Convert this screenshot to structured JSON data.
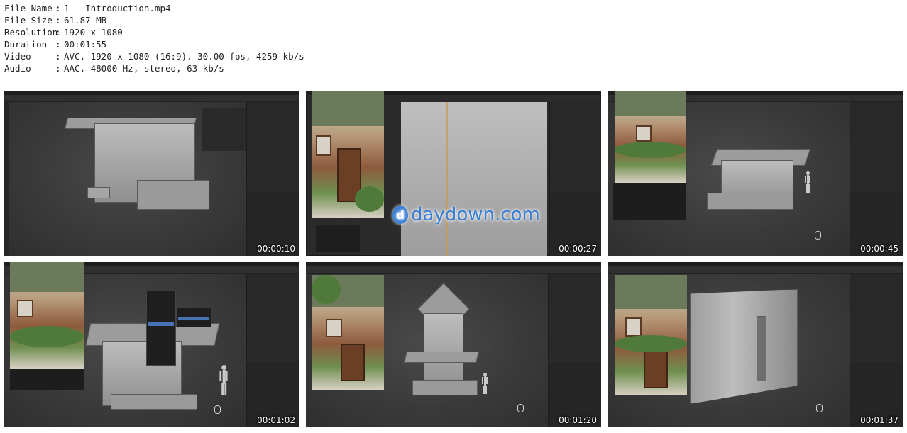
{
  "meta": [
    {
      "key": "File Name",
      "value": "1 - Introduction.mp4"
    },
    {
      "key": "File Size",
      "value": "61.87 MB"
    },
    {
      "key": "Resolution",
      "value": "1920 x 1080"
    },
    {
      "key": "Duration",
      "value": "00:01:55"
    },
    {
      "key": "Video",
      "value": "AVC, 1920 x 1080 (16:9), 30.00 fps, 4259 kb/s"
    },
    {
      "key": "Audio",
      "value": "AAC, 48000 Hz, stereo, 63 kb/s"
    }
  ],
  "separator": ":",
  "thumbnails": [
    {
      "timestamp": "00:00:10"
    },
    {
      "timestamp": "00:00:27"
    },
    {
      "timestamp": "00:00:45"
    },
    {
      "timestamp": "00:01:02"
    },
    {
      "timestamp": "00:01:20"
    },
    {
      "timestamp": "00:01:37"
    }
  ],
  "watermark": {
    "icon_letter": "d",
    "text": "daydown.com"
  },
  "icons": [
    "mouse-icon",
    "watermark-logo-icon"
  ]
}
